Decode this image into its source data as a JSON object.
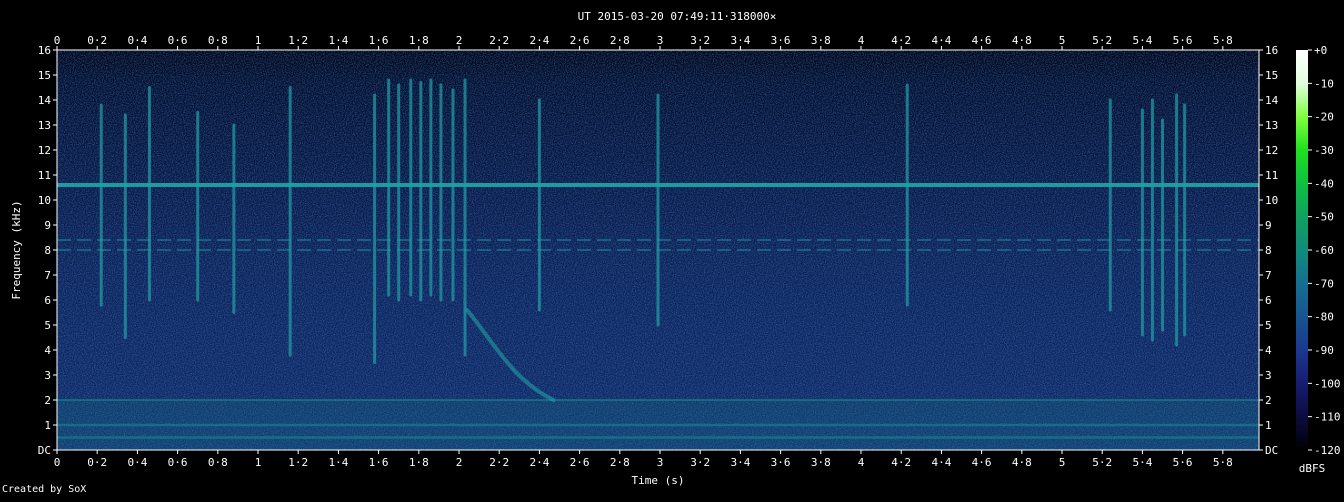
{
  "chart_data": {
    "type": "heatmap",
    "title": "UT 2015-03-20 07:49:11·318000×",
    "xlabel": "Time (s)",
    "ylabel": "Frequency (kHz)",
    "xlim": [
      0,
      5.98
    ],
    "ylim": [
      0,
      16
    ],
    "x_ticks": [
      "0",
      "0·2",
      "0·4",
      "0·6",
      "0·8",
      "1",
      "1·2",
      "1·4",
      "1·6",
      "1·8",
      "2",
      "2·2",
      "2·4",
      "2·6",
      "2·8",
      "3",
      "3·2",
      "3·4",
      "3·6",
      "3·8",
      "4",
      "4·2",
      "4·4",
      "4·6",
      "4·8",
      "5",
      "5·2",
      "5·4",
      "5·6",
      "5·8"
    ],
    "y_ticks": [
      "DC",
      "1",
      "2",
      "3",
      "4",
      "5",
      "6",
      "7",
      "8",
      "9",
      "10",
      "11",
      "12",
      "13",
      "14",
      "15",
      "16"
    ],
    "colorbar": {
      "label": "dBFS",
      "range": [
        -120,
        0
      ],
      "ticks": [
        "+0",
        "-10",
        "-20",
        "-30",
        "-40",
        "-50",
        "-60",
        "-70",
        "-80",
        "-90",
        "-100",
        "-110",
        "-120"
      ],
      "colors": [
        "#ffffff",
        "#e0ffe0",
        "#80ff40",
        "#20e020",
        "#10c040",
        "#10a060",
        "#108c7a",
        "#147090",
        "#185490",
        "#1a3890",
        "#181c70",
        "#0c0c40",
        "#000000"
      ]
    },
    "features": {
      "horizontal_lines_khz": [
        0.5,
        1.0,
        2.0,
        8.0,
        8.4,
        10.6
      ],
      "vertical_events": [
        {
          "t": 0.22,
          "top": 13.8,
          "bottom": 5.8
        },
        {
          "t": 0.34,
          "top": 13.4,
          "bottom": 4.5
        },
        {
          "t": 0.46,
          "top": 14.5,
          "bottom": 6.0
        },
        {
          "t": 0.7,
          "top": 13.5,
          "bottom": 6.0
        },
        {
          "t": 0.88,
          "top": 13.0,
          "bottom": 5.5
        },
        {
          "t": 1.16,
          "top": 14.5,
          "bottom": 3.8
        },
        {
          "t": 1.58,
          "top": 14.2,
          "bottom": 3.5
        },
        {
          "t": 1.65,
          "top": 14.8,
          "bottom": 6.2
        },
        {
          "t": 1.7,
          "top": 14.6,
          "bottom": 6.0
        },
        {
          "t": 1.76,
          "top": 14.8,
          "bottom": 6.2
        },
        {
          "t": 1.81,
          "top": 14.7,
          "bottom": 6.0
        },
        {
          "t": 1.86,
          "top": 14.8,
          "bottom": 6.2
        },
        {
          "t": 1.91,
          "top": 14.6,
          "bottom": 6.0
        },
        {
          "t": 1.97,
          "top": 14.4,
          "bottom": 6.0
        },
        {
          "t": 2.03,
          "top": 14.8,
          "bottom": 3.8
        },
        {
          "t": 2.4,
          "top": 14.0,
          "bottom": 5.6
        },
        {
          "t": 2.99,
          "top": 14.2,
          "bottom": 5.0
        },
        {
          "t": 4.23,
          "top": 14.6,
          "bottom": 5.8
        },
        {
          "t": 5.24,
          "top": 14.0,
          "bottom": 5.6
        },
        {
          "t": 5.4,
          "top": 13.6,
          "bottom": 4.6
        },
        {
          "t": 5.45,
          "top": 14.0,
          "bottom": 4.4
        },
        {
          "t": 5.5,
          "top": 13.2,
          "bottom": 4.8
        },
        {
          "t": 5.57,
          "top": 14.2,
          "bottom": 4.2
        },
        {
          "t": 5.61,
          "top": 13.8,
          "bottom": 4.6
        }
      ],
      "sweep": {
        "t_start": 2.04,
        "f_start": 5.6,
        "t_end": 2.47,
        "f_end": 2.0
      }
    }
  },
  "footer": {
    "credit": "Created by SoX"
  }
}
